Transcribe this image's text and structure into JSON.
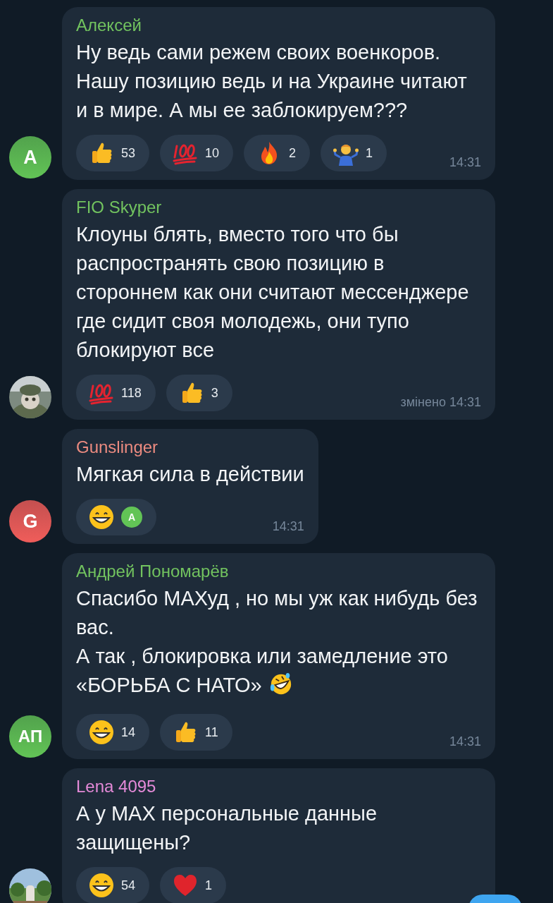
{
  "messages": [
    {
      "author": {
        "name": "Алексей",
        "color": "#72c35f"
      },
      "avatar": {
        "kind": "letter",
        "initials": "A",
        "color": "#62c456"
      },
      "text": "Ну ведь сами режем своих военкоров. Нашу позицию ведь и на Украине читают и в мире. А мы ее заблокируем???",
      "reactions": [
        {
          "kind": "thumbs",
          "count": "53"
        },
        {
          "kind": "hundred",
          "count": "10"
        },
        {
          "kind": "fire",
          "count": "2"
        },
        {
          "kind": "shrug",
          "count": "1"
        }
      ],
      "time": "14:31"
    },
    {
      "author": {
        "name": "FIO Skyper",
        "color": "#72c35f"
      },
      "text": "Клоуны блять, вместо того что бы распространять свою позицию в стороннем как они считают мессенджере где сидит своя молодежь, они тупо блокируют все",
      "reactions": [
        {
          "kind": "hundred",
          "count": "118"
        },
        {
          "kind": "thumbs",
          "count": "3"
        }
      ],
      "time": "змінено 14:31"
    },
    {
      "author": {
        "name": "Gunslinger",
        "color": "#ec8b80"
      },
      "avatar": {
        "kind": "letter",
        "initials": "G",
        "color": "#f05d5a"
      },
      "text": "Мягкая сила в действии",
      "reactions": [
        {
          "kind": "grin",
          "reactors": [
            {
              "initial": "A",
              "color": "#62c456"
            }
          ]
        }
      ],
      "time": "14:31"
    },
    {
      "author": {
        "name": "Андрей Пономарёв",
        "color": "#72c35f"
      },
      "avatar": {
        "kind": "letter",
        "initials": "АП",
        "color": "#62c456"
      },
      "text": "Спасибо МАХуд , но мы уж как нибудь без вас.\nА так , блокировка или замедление это «БОРЬБА С НАТО»",
      "trailing_emoji": {
        "kind": "rofl"
      },
      "reactions": [
        {
          "kind": "grin",
          "count": "14"
        },
        {
          "kind": "thumbs",
          "count": "11"
        }
      ],
      "time": "14:31"
    },
    {
      "author": {
        "name": "Lena 4095",
        "color": "#e48ad8"
      },
      "text": "А у МАХ персональные данные защищены?",
      "reactions": [
        {
          "kind": "grin",
          "count": "54"
        },
        {
          "kind": "heart",
          "count": "1"
        }
      ]
    }
  ],
  "scroll_button": {
    "visible": true
  }
}
